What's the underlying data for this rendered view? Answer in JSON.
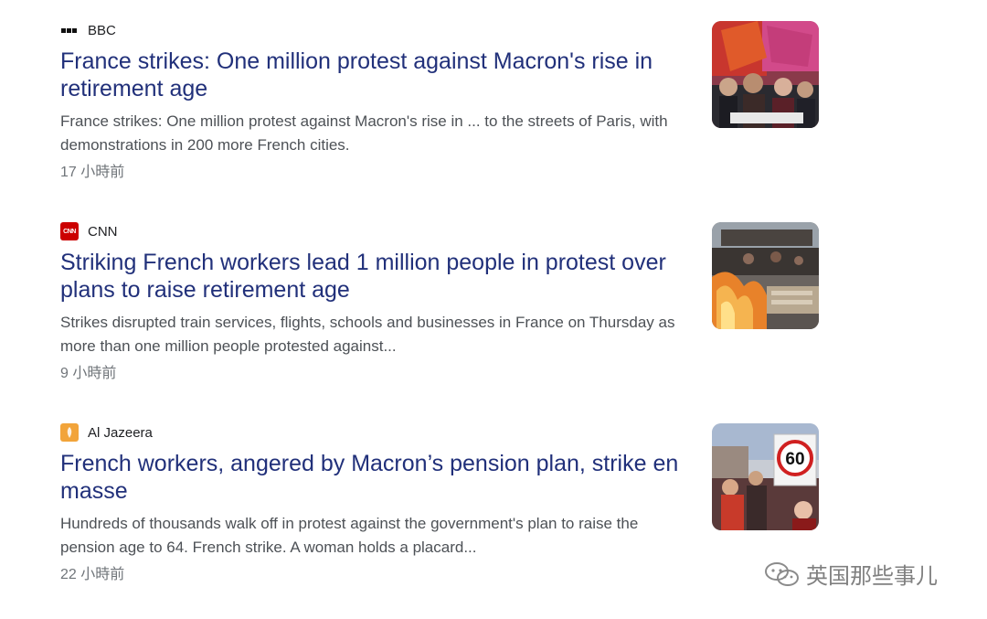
{
  "results": [
    {
      "source": "BBC",
      "favicon": "bbc-logo-icon",
      "title": "France strikes: One million protest against Macron's rise in retirement age",
      "snippet": "France strikes: One million protest against Macron's rise in ... to the streets of Paris, with demonstrations in 200 more French cities.",
      "time": "17 小時前",
      "thumbnail": "protest-crowd-flags-photo"
    },
    {
      "source": "CNN",
      "favicon": "cnn-logo-icon",
      "title": "Striking French workers lead 1 million people in protest over plans to raise retirement age",
      "snippet": "Strikes disrupted train services, flights, schools and businesses in France on Thursday as more than one million people protested against...",
      "time": "9 小時前",
      "thumbnail": "street-fire-protest-photo"
    },
    {
      "source": "Al Jazeera",
      "favicon": "al-jazeera-logo-icon",
      "title": "French workers, angered by Macron’s pension plan, strike en masse",
      "snippet": "Hundreds of thousands walk off in protest against the government's plan to raise the pension age to 64. French strike. A woman holds a placard...",
      "time": "22 小時前",
      "thumbnail": "placard-60-protest-photo"
    }
  ],
  "cnn_favicon_text": "CNN",
  "placard_text": "60",
  "watermark": {
    "text": "英国那些事儿",
    "icon": "wechat-icon"
  },
  "colors": {
    "title": "#21307a",
    "snippet": "#4d5156",
    "time": "#70757a",
    "cnn_red": "#cc0000",
    "aj_gold": "#f2a43a"
  }
}
